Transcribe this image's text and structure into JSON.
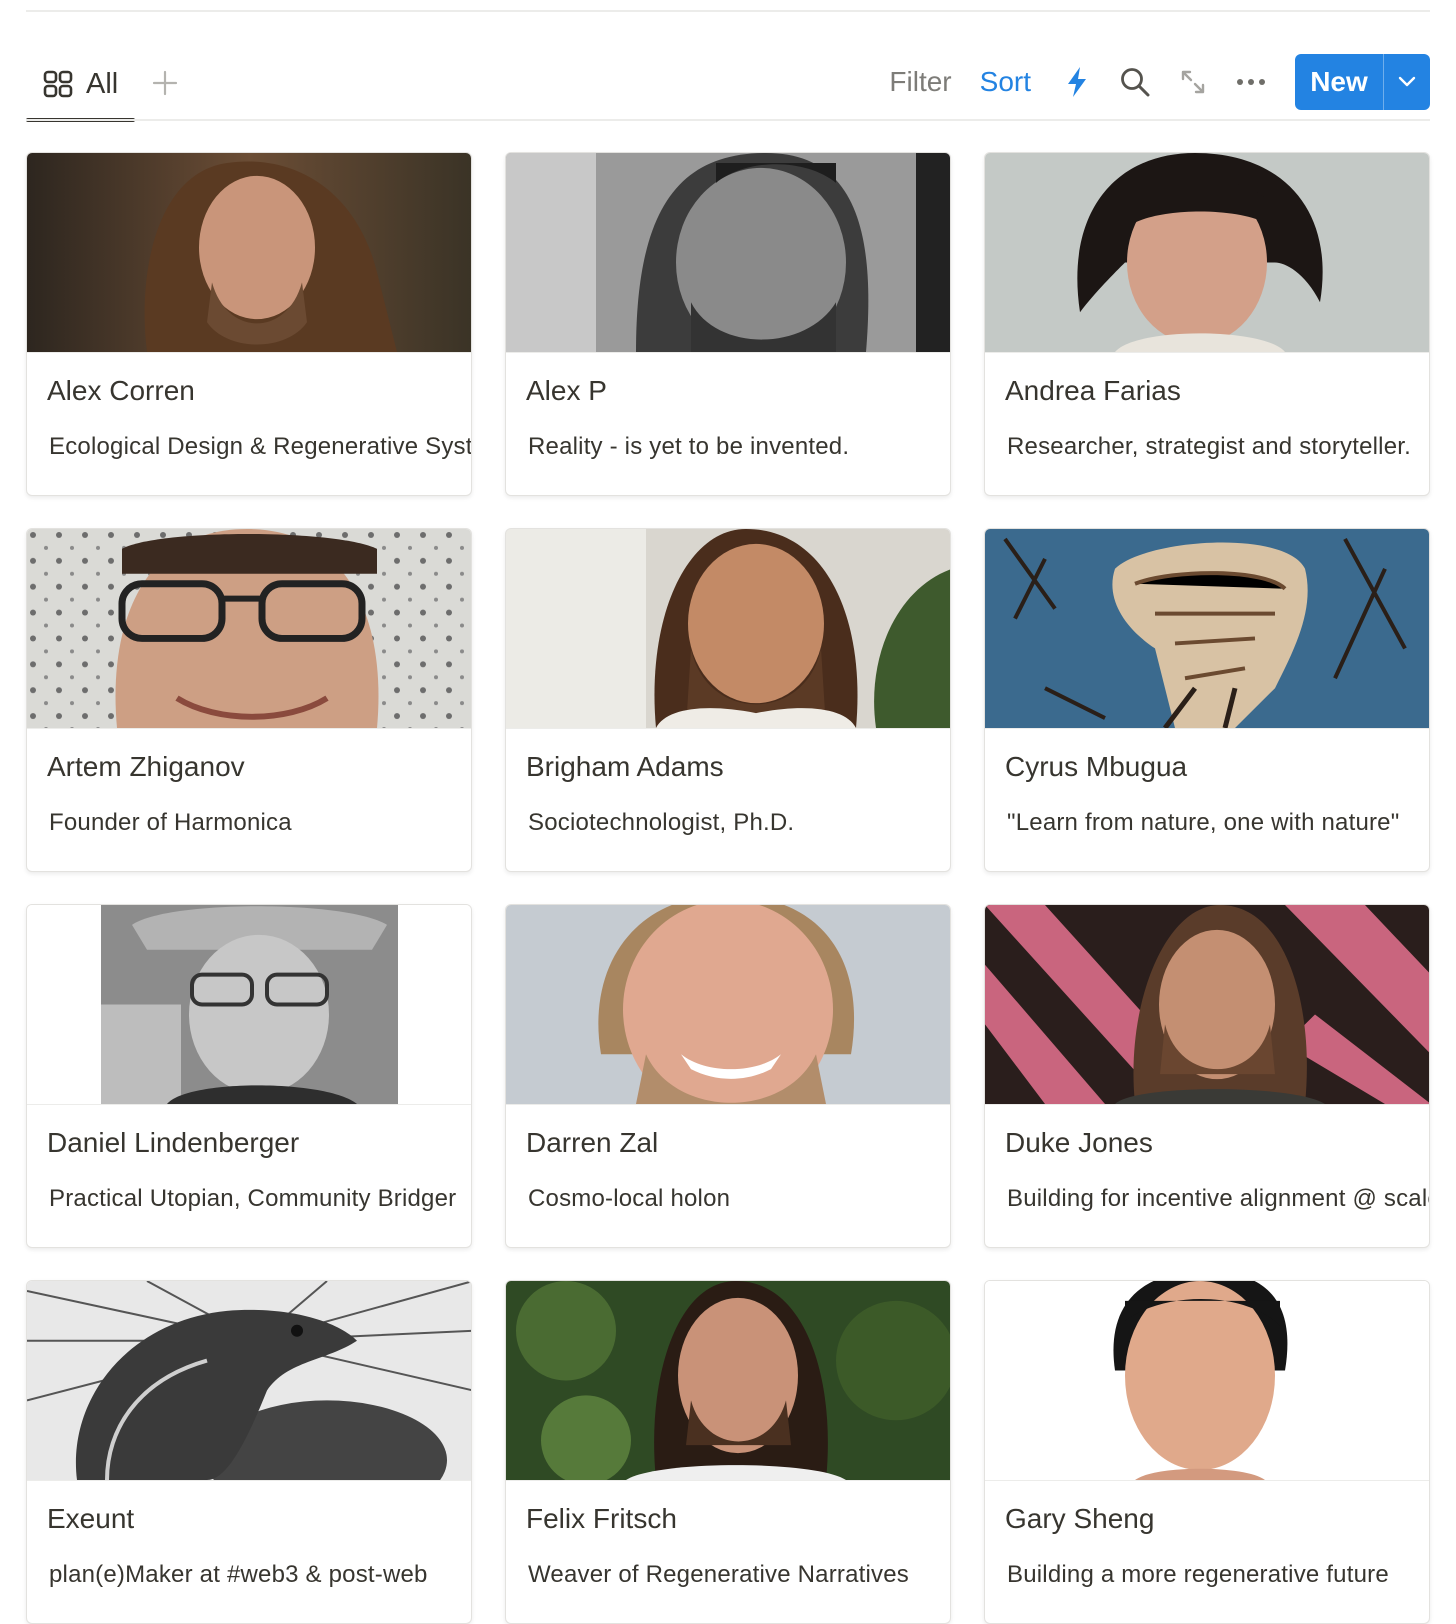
{
  "view": {
    "tab_label": "All"
  },
  "toolbar": {
    "filter_label": "Filter",
    "sort_label": "Sort",
    "new_label": "New",
    "accent_color": "#2383e2",
    "icons": [
      "lightning-icon",
      "search-icon",
      "expand-icon",
      "more-icon"
    ]
  },
  "cards": [
    {
      "name": "Alex Corren",
      "description": "Ecological Design & Regenerative Systems"
    },
    {
      "name": "Alex P",
      "description": "Reality - is yet to be invented."
    },
    {
      "name": "Andrea Farias",
      "description": "Researcher, strategist and storyteller."
    },
    {
      "name": "Artem Zhiganov",
      "description": "Founder of Harmonica"
    },
    {
      "name": "Brigham Adams",
      "description": "Sociotechnologist, Ph.D."
    },
    {
      "name": "Cyrus Mbugua",
      "description": "\"Learn from nature, one with nature\""
    },
    {
      "name": "Daniel Lindenberger",
      "description": "Practical Utopian, Community Bridger"
    },
    {
      "name": "Darren Zal",
      "description": "Cosmo-local holon"
    },
    {
      "name": "Duke Jones",
      "description": "Building for incentive alignment @ scale"
    },
    {
      "name": "Exeunt",
      "description": "plan(e)Maker at #web3 & post-web"
    },
    {
      "name": "Felix Fritsch",
      "description": "Weaver of Regenerative Narratives"
    },
    {
      "name": "Gary Sheng",
      "description": "Building a more regenerative future"
    }
  ]
}
